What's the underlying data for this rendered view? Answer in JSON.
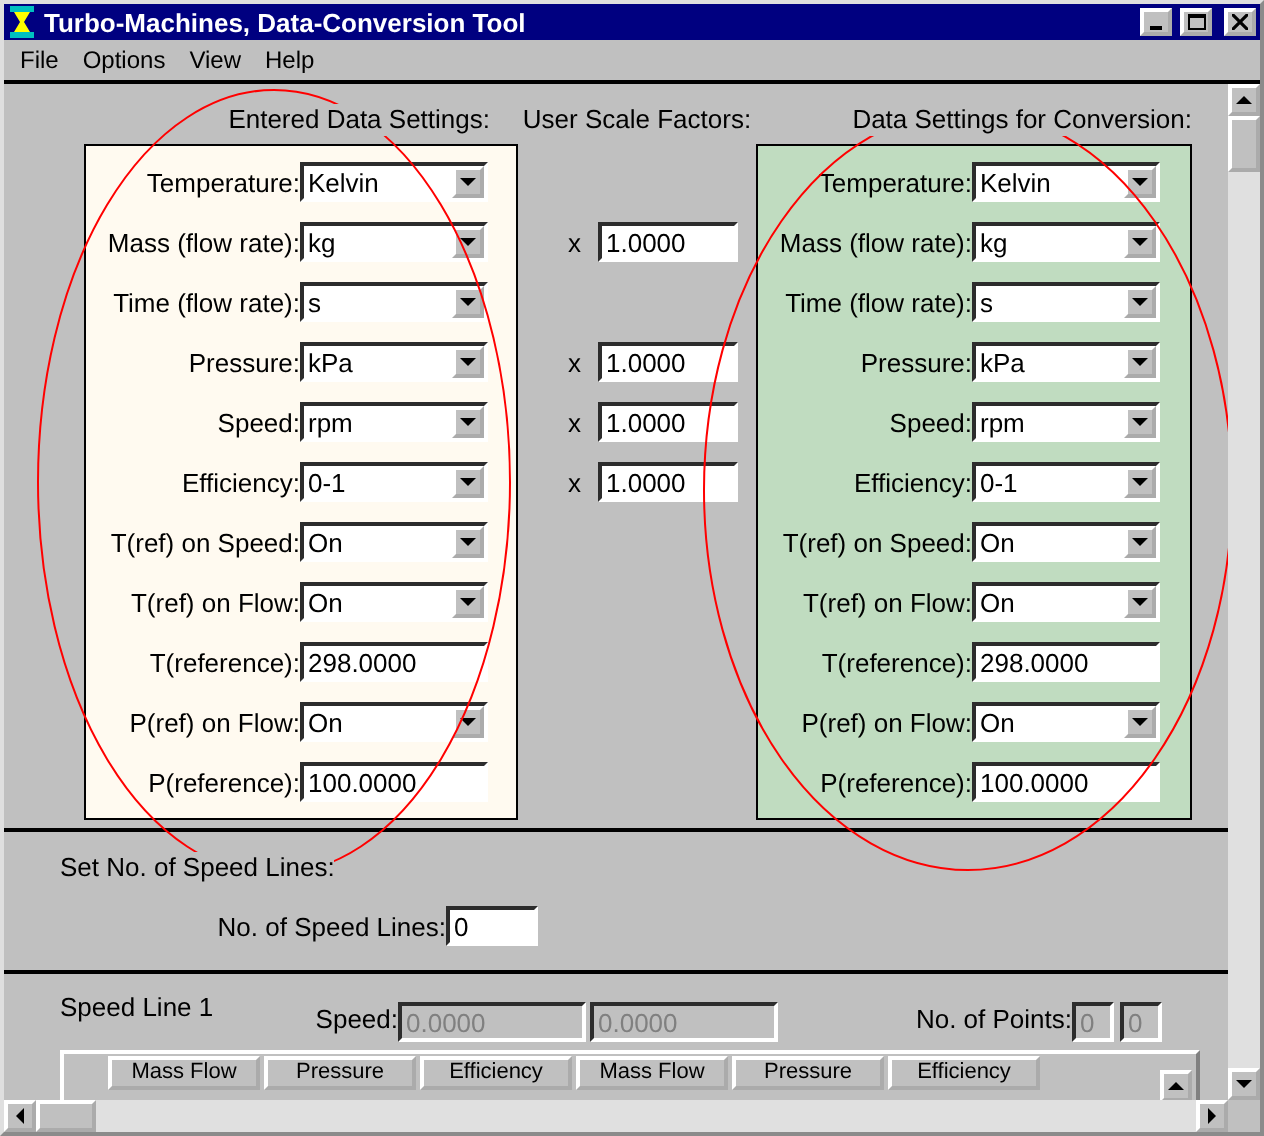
{
  "window": {
    "title": "Turbo-Machines, Data-Conversion Tool"
  },
  "menu": [
    {
      "label": "File"
    },
    {
      "label": "Options"
    },
    {
      "label": "View"
    },
    {
      "label": "Help"
    }
  ],
  "settings_panels": [
    {
      "heading": "Entered Data Settings:",
      "color": "#fffaf0",
      "rows": [
        {
          "label": "Temperature:",
          "kind": "dropdown",
          "value": "Kelvin"
        },
        {
          "label": "Mass (flow rate):",
          "kind": "dropdown",
          "value": "kg"
        },
        {
          "label": "Time (flow rate):",
          "kind": "dropdown",
          "value": "s"
        },
        {
          "label": "Pressure:",
          "kind": "dropdown",
          "value": "kPa"
        },
        {
          "label": "Speed:",
          "kind": "dropdown",
          "value": "rpm"
        },
        {
          "label": "Efficiency:",
          "kind": "dropdown",
          "value": "0-1"
        },
        {
          "label": "T(ref) on Speed:",
          "kind": "dropdown",
          "value": "On"
        },
        {
          "label": "T(ref) on Flow:",
          "kind": "dropdown",
          "value": "On"
        },
        {
          "label": "T(reference):",
          "kind": "input",
          "value": "298.0000"
        },
        {
          "label": "P(ref) on Flow:",
          "kind": "dropdown",
          "value": "On"
        },
        {
          "label": "P(reference):",
          "kind": "input",
          "value": "100.0000"
        }
      ]
    },
    {
      "heading": "Data Settings for Conversion:",
      "color": "#c0dcc0",
      "rows": [
        {
          "label": "Temperature:",
          "kind": "dropdown",
          "value": "Kelvin"
        },
        {
          "label": "Mass (flow rate):",
          "kind": "dropdown",
          "value": "kg"
        },
        {
          "label": "Time (flow rate):",
          "kind": "dropdown",
          "value": "s"
        },
        {
          "label": "Pressure:",
          "kind": "dropdown",
          "value": "kPa"
        },
        {
          "label": "Speed:",
          "kind": "dropdown",
          "value": "rpm"
        },
        {
          "label": "Efficiency:",
          "kind": "dropdown",
          "value": "0-1"
        },
        {
          "label": "T(ref) on Speed:",
          "kind": "dropdown",
          "value": "On"
        },
        {
          "label": "T(ref) on Flow:",
          "kind": "dropdown",
          "value": "On"
        },
        {
          "label": "T(reference):",
          "kind": "input",
          "value": "298.0000"
        },
        {
          "label": "P(ref) on Flow:",
          "kind": "dropdown",
          "value": "On"
        },
        {
          "label": "P(reference):",
          "kind": "input",
          "value": "100.0000"
        }
      ]
    }
  ],
  "scale_factors": {
    "heading": "User Scale Factors:",
    "rows": [
      {
        "kind": "empty"
      },
      {
        "kind": "factor",
        "sign": "x",
        "value": "1.0000"
      },
      {
        "kind": "empty"
      },
      {
        "kind": "factor",
        "sign": "x",
        "value": "1.0000"
      },
      {
        "kind": "factor",
        "sign": "x",
        "value": "1.0000"
      },
      {
        "kind": "factor",
        "sign": "x",
        "value": "1.0000"
      }
    ]
  },
  "speed_lines_section": {
    "heading": "Set No. of Speed Lines:",
    "label": "No. of Speed Lines:",
    "value": "0"
  },
  "speed_line": {
    "title": "Speed Line 1",
    "speed_label": "Speed:",
    "speed_fields": [
      {
        "value": "0.0000",
        "disabled": true
      },
      {
        "value": "0.0000",
        "disabled": true
      }
    ],
    "points_label": "No. of Points:",
    "points_fields": [
      {
        "value": "0",
        "disabled": true
      },
      {
        "value": "0",
        "disabled": true
      }
    ]
  },
  "table": {
    "columns": [
      "Mass Flow",
      "Pressure",
      "Efficiency",
      "Mass Flow",
      "Pressure",
      "Efficiency"
    ]
  },
  "annotations": [
    {
      "kind": "ellipse",
      "color": "#ff0000"
    },
    {
      "kind": "ellipse",
      "color": "#ff0000"
    }
  ]
}
